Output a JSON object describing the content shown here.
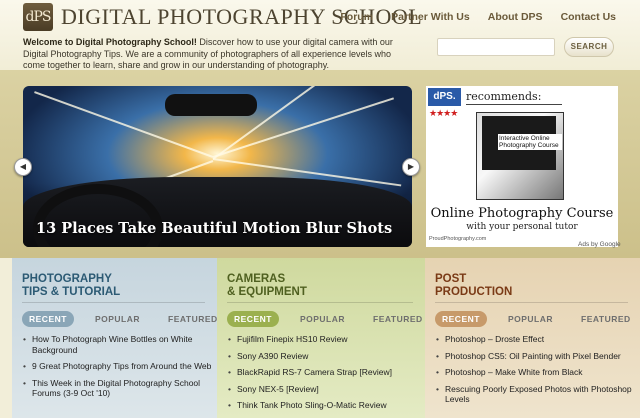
{
  "header": {
    "logo_text": "dPS",
    "site_title": "DIGITAL PHOTOGRAPHY SCHOOL",
    "nav": [
      "Forum",
      "Partner With Us",
      "About DPS",
      "Contact Us"
    ],
    "welcome_bold": "Welcome to Digital Photography School!",
    "welcome_text": " Discover how to use your digital camera with our Digital Photography Tips. We are a community of photographers of all experience levels who come together to learn, share and grow in our understanding of photography.",
    "search_placeholder": "",
    "search_button": "SEARCH"
  },
  "feature": {
    "caption": "13 Places Take Beautiful Motion Blur Shots",
    "prev_icon": "chevron-left-icon",
    "next_icon": "chevron-right-icon"
  },
  "ad": {
    "logo": "dPS.",
    "recommends": "recommends:",
    "stars": "★★★★",
    "box_title": "Interactive Online Photography Course",
    "title": "Online Photography Course",
    "subtitle": "with your personal tutor",
    "url": "ProudPhotography.com",
    "ads_by": "Ads by Google"
  },
  "columns": [
    {
      "title_line1": "PHOTOGRAPHY",
      "title_line2": "TIPS & TUTORIAL",
      "tabs": [
        "RECENT",
        "POPULAR",
        "FEATURED"
      ],
      "items": [
        "How To Photograph Wine Bottles on White Background",
        "9 Great Photography Tips from Around the Web",
        "This Week in the Digital Photography School Forums (3-9 Oct '10)"
      ]
    },
    {
      "title_line1": "CAMERAS",
      "title_line2": "& EQUIPMENT",
      "tabs": [
        "RECENT",
        "POPULAR",
        "FEATURED"
      ],
      "items": [
        "Fujifilm Finepix HS10 Review",
        "Sony A390 Review",
        "BlackRapid RS-7 Camera Strap [Review]",
        "Sony NEX-5 [Review]",
        "Think Tank Photo Sling-O-Matic Review"
      ]
    },
    {
      "title_line1": "POST",
      "title_line2": "PRODUCTION",
      "tabs": [
        "RECENT",
        "POPULAR",
        "FEATURED"
      ],
      "items": [
        "Photoshop – Droste Effect",
        "Photoshop CS5: Oil Painting with Pixel Bender",
        "Photoshop – Make White from Black",
        "Rescuing Poorly Exposed Photos with Photoshop Levels"
      ]
    }
  ]
}
